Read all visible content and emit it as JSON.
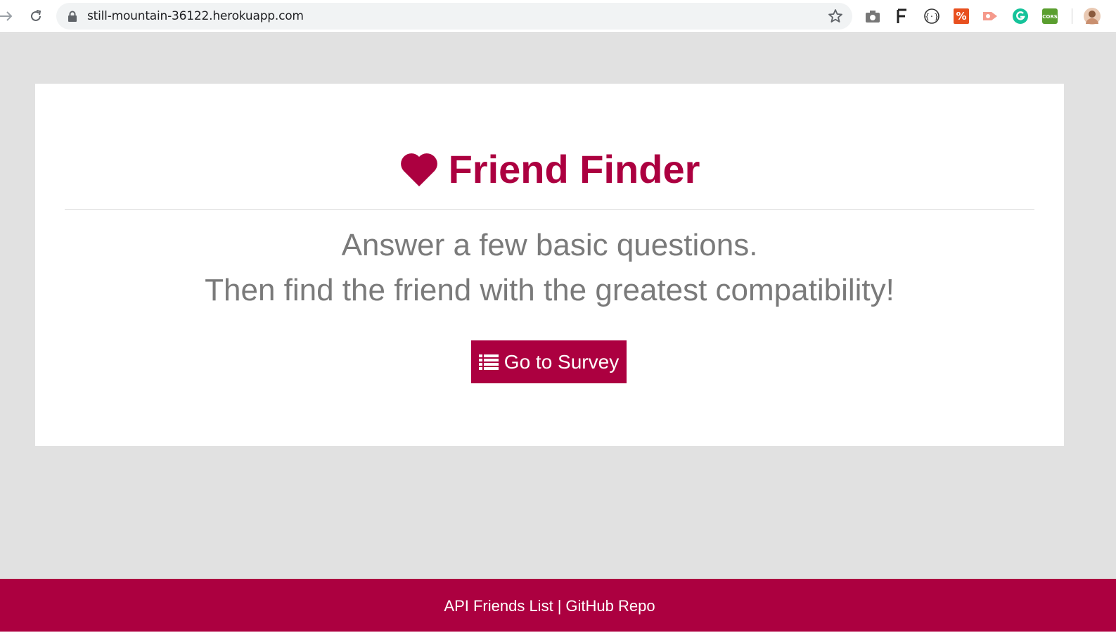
{
  "browser": {
    "url": "still-mountain-36122.herokuapp.com",
    "extensions": [
      "camera-icon",
      "f-extension-icon",
      "braces-icon",
      "percent-extension-icon",
      "recorder-icon",
      "grammarly-icon",
      "cors-icon",
      "profile-avatar"
    ],
    "cors_label": "CORS"
  },
  "hero": {
    "title": "Friend Finder",
    "lead_line1": "Answer a few basic questions.",
    "lead_line2": "Then find the friend with the greatest compatibility!",
    "survey_button": "Go to Survey"
  },
  "footer": {
    "api_link": "API Friends List",
    "separator": "|",
    "github_link": "GitHub Repo"
  },
  "colors": {
    "brand": "#ac0040",
    "lead_text": "#7a7a7a",
    "page_bg": "#e1e1e1"
  }
}
